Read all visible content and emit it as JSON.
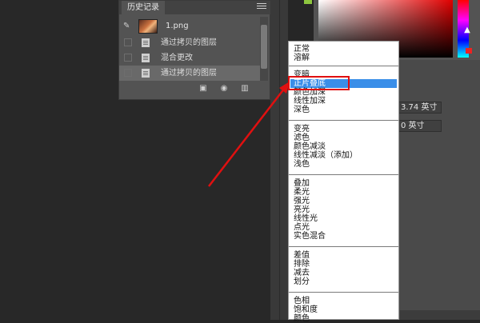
{
  "history_panel": {
    "title": "历史记录",
    "snapshot": {
      "name": "1.png"
    },
    "items": [
      {
        "label": "通过拷贝的图层",
        "selected": false
      },
      {
        "label": "混合更改",
        "selected": false
      },
      {
        "label": "通过拷贝的图层",
        "selected": true
      }
    ],
    "footer_icons": [
      "new-document-icon",
      "camera-icon",
      "trash-icon"
    ]
  },
  "properties_panel": {
    "width_field": "3.74 英寸",
    "height_field": "0 英寸"
  },
  "blend_menu": {
    "groups": [
      [
        "正常",
        "溶解"
      ],
      [
        "变暗",
        "正片叠底",
        "颜色加深",
        "线性加深",
        "深色"
      ],
      [
        "变亮",
        "滤色",
        "颜色减淡",
        "线性减淡（添加）",
        "浅色"
      ],
      [
        "叠加",
        "柔光",
        "强光",
        "亮光",
        "线性光",
        "点光",
        "实色混合"
      ],
      [
        "差值",
        "排除",
        "减去",
        "划分"
      ],
      [
        "色相",
        "饱和度",
        "颜色"
      ]
    ],
    "highlighted": "正片叠底"
  },
  "colors": {
    "annotation": "#e01010",
    "highlight": "#3a8ee8"
  }
}
